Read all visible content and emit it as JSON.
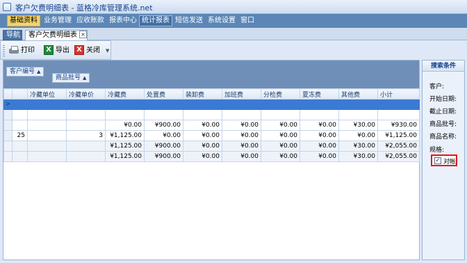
{
  "window": {
    "title": "客户欠费明细表 - 蓝格冷库管理系统.net"
  },
  "menu": {
    "items": [
      {
        "label": "基础资料"
      },
      {
        "label": "业务管理"
      },
      {
        "label": "应收账款"
      },
      {
        "label": "报表中心"
      },
      {
        "label": "统计报表"
      },
      {
        "label": "短信发送"
      },
      {
        "label": "系统设置"
      },
      {
        "label": "窗口"
      }
    ],
    "active_item": "基础资料",
    "hover_item": "统计报表"
  },
  "tabs": {
    "nav_label": "导航",
    "doc_label": "客户欠费明细表",
    "close_glyph": "×"
  },
  "toolbar": {
    "print_label": "打印",
    "export_label": "导出",
    "close_label": "关闭",
    "excel_glyph": "X",
    "close_glyph": "X"
  },
  "group_panel": {
    "fields": [
      {
        "label": "客户编号",
        "arrow": "▲"
      },
      {
        "label": "商品批号",
        "arrow": "▲"
      }
    ]
  },
  "grid": {
    "columns": [
      "",
      "冷藏单位",
      "冷藏单价",
      "冷藏费",
      "处置费",
      "装卸费",
      "加班费",
      "分检费",
      "夏冻费",
      "其他费",
      "小计"
    ],
    "row_indicator": ">",
    "rows": [
      [
        "",
        "",
        "",
        "",
        "",
        "",
        "",
        "",
        "",
        "",
        ""
      ],
      [
        "",
        "",
        "",
        "",
        "",
        "",
        "",
        "",
        "",
        "",
        ""
      ],
      [
        "",
        "",
        "",
        "¥0.00",
        "¥900.00",
        "¥0.00",
        "¥0.00",
        "¥0.00",
        "¥0.00",
        "¥30.00",
        "¥930.00"
      ],
      [
        "25",
        "",
        "3",
        "¥1,125.00",
        "¥0.00",
        "¥0.00",
        "¥0.00",
        "¥0.00",
        "¥0.00",
        "¥0.00",
        "¥1,125.00"
      ],
      [
        "",
        "",
        "",
        "¥1,125.00",
        "¥900.00",
        "¥0.00",
        "¥0.00",
        "¥0.00",
        "¥0.00",
        "¥30.00",
        "¥2,055.00"
      ],
      [
        "",
        "",
        "",
        "¥1,125.00",
        "¥900.00",
        "¥0.00",
        "¥0.00",
        "¥0.00",
        "¥0.00",
        "¥30.00",
        "¥2,055.00"
      ]
    ]
  },
  "search_panel": {
    "title": "搜索条件",
    "labels": [
      "客户:",
      "开始日期:",
      "截止日期:",
      "商品批号:",
      "商品名称:",
      "规格:"
    ],
    "checkbox": {
      "label": "对帐",
      "checked": true,
      "glyph": "✓"
    }
  },
  "colors": {
    "menubar": "#5b86b6",
    "selected_row": "#3b7ad4",
    "highlight_border": "#e01818"
  }
}
